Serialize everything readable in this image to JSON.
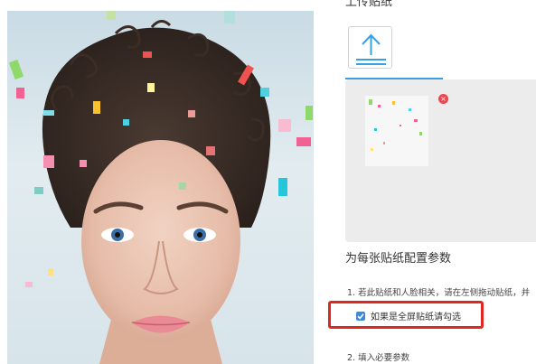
{
  "upload": {
    "title": "上传贴纸",
    "button_icon": "upload-arrow-icon",
    "remove_icon": "close-icon",
    "remove_symbol": "×"
  },
  "config": {
    "title": "为每张贴纸配置参数",
    "step1": "1. 若此贴纸和人脸相关，请在左侧拖动贴纸，并",
    "fullscreen_checkbox": {
      "label": "如果是全屏贴纸请勾选",
      "checked": true
    },
    "step2": "2. 填入必要参数"
  },
  "colors": {
    "accent": "#3aa0e0",
    "checkbox": "#3a8be0",
    "highlight": "#e0271f",
    "remove": "#e8484f"
  }
}
